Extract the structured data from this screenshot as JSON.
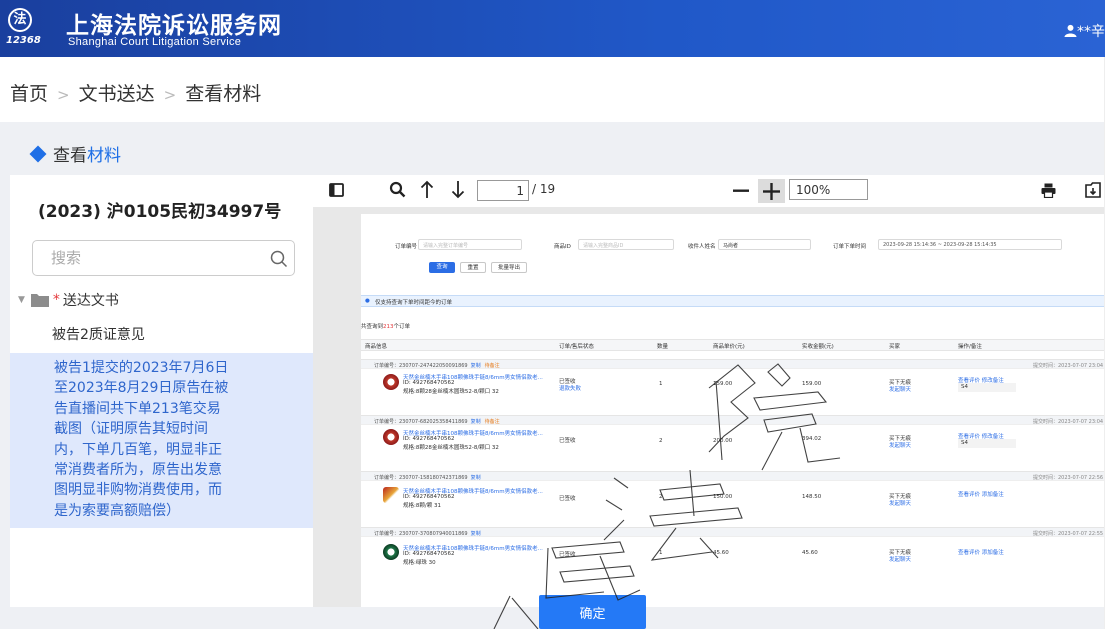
{
  "header": {
    "logo_seal": "法",
    "logo_number": "12368",
    "title": "上海法院诉讼服务网",
    "subtitle": "Shanghai Court Litigation Service",
    "user": "**辛"
  },
  "breadcrumb": [
    "首页",
    "文书送达",
    "查看材料"
  ],
  "section": {
    "title_prefix": "查看",
    "title_highlight": "材料"
  },
  "left": {
    "case_number": "(2023) 沪0105民初34997号",
    "search_placeholder": "搜索",
    "folder": {
      "required_mark": "*",
      "label": "送达文书"
    },
    "items": [
      "被告2质证意见",
      "被告1提交的2023年7月6日至2023年8月29日原告在被告直播间共下单213笔交易截图（证明原告其短时间内，下单几百笔，明显非正常消费者所为，原告出发意图明显非购物消费使用，而是为索要高额赔偿）"
    ]
  },
  "viewer": {
    "page_current": "1",
    "page_total": "/ 19",
    "zoom": "100%"
  },
  "doc": {
    "filters": {
      "order_no_label": "订单编号",
      "order_no_ph": "请输入完整订单编号",
      "goods_id_label": "商品ID",
      "goods_id_ph": "请输入完整商品ID",
      "receiver_label": "收件人姓名",
      "receiver_value": "马尚者",
      "time_label": "订单下单时间",
      "time_value": "2023-09-28 15:14:36 ~ 2023-09-28 15:14:35"
    },
    "buttons": [
      "查询",
      "重置",
      "批量导出"
    ],
    "notice": "仅支持查询下单时间距今的订单",
    "found_prefix": "共查询到",
    "found_count": "213",
    "found_suffix": "个订单",
    "columns": [
      "商品信息",
      "订单/售后状态",
      "数量",
      "商品单价(元)",
      "实收金额(元)",
      "买家",
      "操作/备注"
    ],
    "orders": [
      {
        "no": "订单编号：230707-247422050091869",
        "copy": "复制",
        "memo": "待备注",
        "submitted": "提交时间：2023-07-07 23:04",
        "title": "天然金丝楠木手串108颗佛珠手链8/6mm男女情侣款老...",
        "id": "ID: 492768470562",
        "spec": "规格:8颗28金丝楠木圆珠52-8/颗口 32",
        "status": "已签收",
        "status2": "退款失败",
        "qty": "1",
        "price": "159.00",
        "paid": "159.00",
        "buyer": "买下无痕",
        "buyer2": "发起聊天",
        "ops": "查看评价  修改备注",
        "ops_tag": "S4"
      },
      {
        "no": "订单编号：230707-682025358411869",
        "copy": "复制",
        "memo": "待备注",
        "submitted": "提交时间：2023-07-07 23:04",
        "title": "天然金丝楠木手串108颗佛珠手链8/6mm男女情侣款老...",
        "id": "ID: 492768470562",
        "spec": "规格:8颗28金丝楠木圆珠52-8/颗口 32",
        "status": "已签收",
        "status2": "",
        "qty": "2",
        "price": "200.00",
        "paid": "394.02",
        "buyer": "买下无痕",
        "buyer2": "发起聊天",
        "ops": "查看评价  修改备注",
        "ops_tag": "S4"
      },
      {
        "no": "订单编号：230707-158180742371869",
        "copy": "复制",
        "memo": "",
        "submitted": "提交时间：2023-07-07 22:56",
        "title": "天然金丝楠木手串108颗佛珠手链8/6mm男女情侣款老...",
        "id": "ID: 492768470562",
        "spec": "规格:8颗/颗 31",
        "status": "已签收",
        "status2": "",
        "qty": "2",
        "price": "150.00",
        "paid": "148.50",
        "buyer": "买下无痕",
        "buyer2": "发起聊天",
        "ops": "查看评价  添加备注",
        "ops_tag": ""
      },
      {
        "no": "订单编号：230707-370807940011869",
        "copy": "复制",
        "memo": "",
        "submitted": "提交时间：2023-07-07 22:55",
        "title": "天然金丝楠木手串108颗佛珠手链8/6mm男女情侣款老...",
        "id": "ID: 492768470562",
        "spec": "规格:绿珠 30",
        "status": "已签收",
        "status2": "",
        "qty": "1",
        "price": "45.60",
        "paid": "45.60",
        "buyer": "买下无痕",
        "buyer2": "发起聊天",
        "ops": "查看评价  添加备注",
        "ops_tag": ""
      }
    ]
  },
  "confirm_label": "确定",
  "watermark_text": "人民法院"
}
